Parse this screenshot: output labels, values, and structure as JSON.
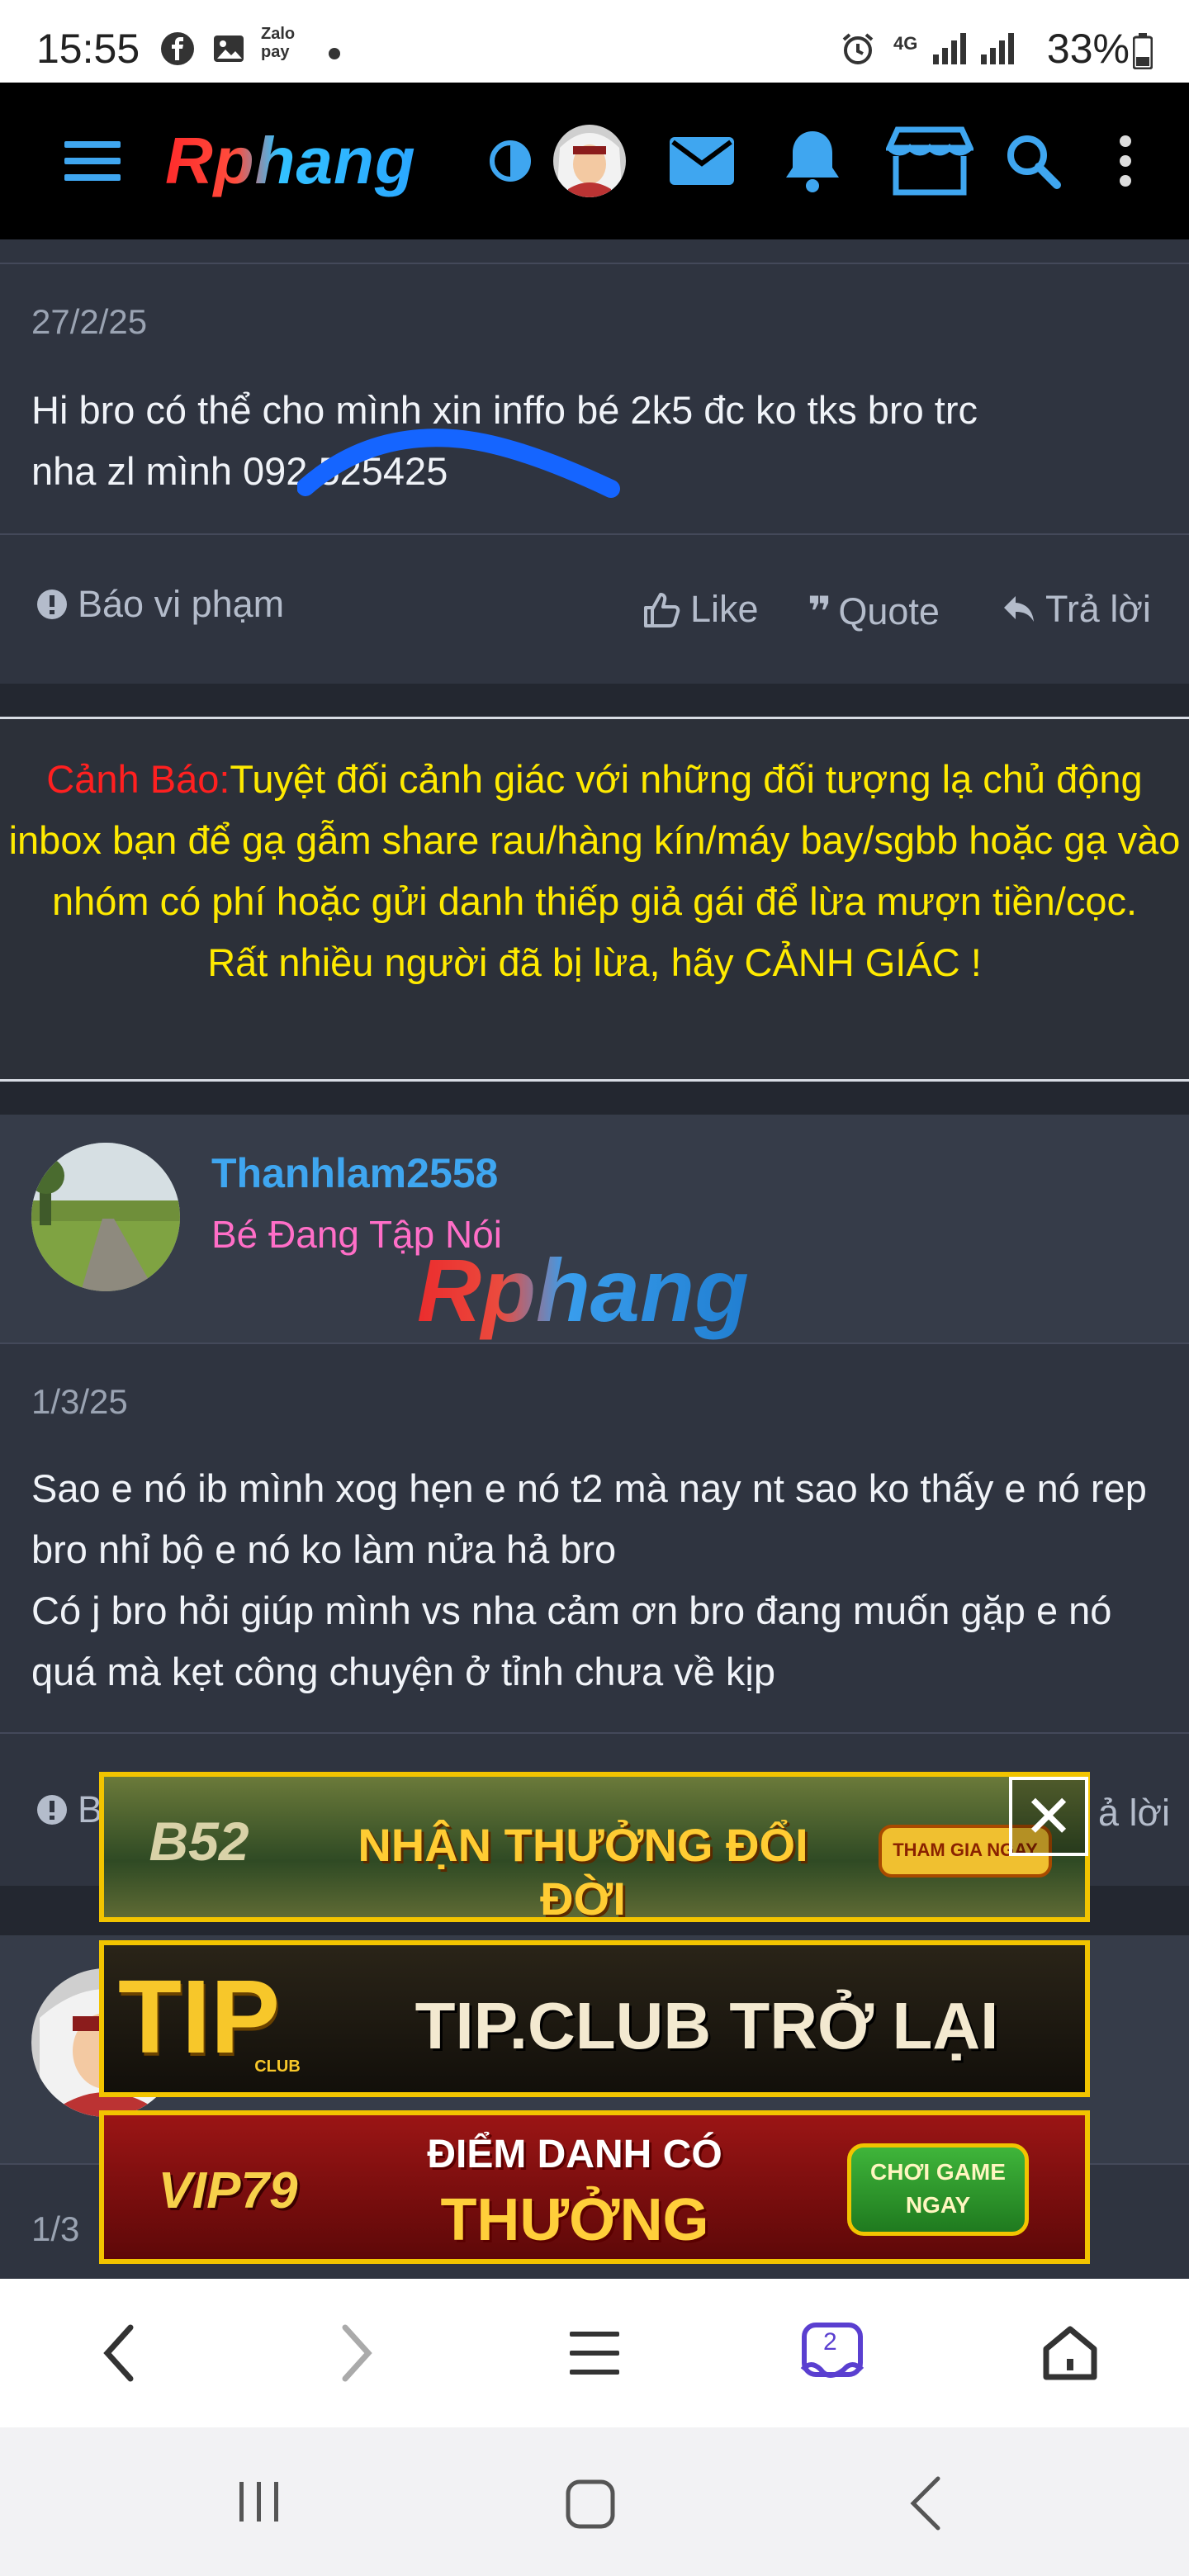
{
  "status_bar": {
    "time": "15:55",
    "network": "4G",
    "battery": "33%"
  },
  "header": {
    "logo": "Rphang"
  },
  "post1": {
    "date": "27/2/25",
    "body": "Hi bro có thể cho mình xin inffo bé 2k5 đc ko tks bro trc\nnha zl mình 092     525425",
    "report": "Báo vi phạm",
    "like": "Like",
    "quote": "Quote",
    "reply": "Trả lời"
  },
  "warning": {
    "prefix": "Cảnh Báo:",
    "text": "Tuyệt đối cảnh giác với những đối tượng lạ chủ động inbox bạn để gạ gẫm share rau/hàng kín/máy bay/sgbb hoặc gạ vào nhóm có phí hoặc gửi danh thiếp giả gái để lừa mượn tiền/cọc.",
    "line2": "Rất nhiều người đã bị lừa, hãy CẢNH GIÁC !"
  },
  "post2": {
    "username": "Thanhlam2558",
    "user_title": "Bé Đang Tập Nói",
    "watermark": "Rphang",
    "date": "1/3/25",
    "body": "Sao e nó ib mình xog hẹn e nó t2 mà nay nt sao ko thấy e nó rep bro nhỉ bộ e nó ko làm nửa hả bro\nCó j bro hỏi giúp mình vs nha cảm ơn bro đang muốn gặp e nó quá mà kẹt công chuyện ở tỉnh chưa về kịp",
    "report_partial": "B",
    "reply_partial": "ả lời"
  },
  "post3": {
    "date_partial": "1/3"
  },
  "ads": {
    "ad1_brand": "B52",
    "ad1_text": "NHẬN THƯỞNG ĐỔI ĐỜI",
    "ad1_cta": "THAM GIA NGAY",
    "ad2_brand": "TIP",
    "ad2_sub": "CLUB",
    "ad2_text": "TIP.CLUB TRỞ LẠI",
    "ad3_brand": "VIP79",
    "ad3_text_top": "ĐIỂM DANH CÓ",
    "ad3_text_bottom": "THƯỞNG",
    "ad3_cta_top": "CHƠI GAME",
    "ad3_cta_bottom": "NGAY"
  },
  "browser": {
    "tab_count": "2"
  },
  "colors": {
    "accent_blue": "#3fa6f0",
    "warning_yellow": "#ffea00",
    "warning_red": "#ff2020",
    "title_pink": "#ff6ec7"
  }
}
